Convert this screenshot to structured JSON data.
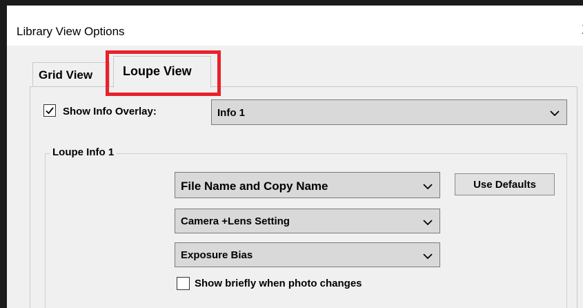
{
  "window": {
    "title": "Library View Options",
    "close_glyph": "X"
  },
  "tabs": [
    {
      "label": "Grid View",
      "selected": false
    },
    {
      "label": "Loupe View",
      "selected": true
    }
  ],
  "highlight": {
    "color": "#e8212b",
    "target": "Loupe View tab"
  },
  "overlay": {
    "checkbox_label": "Show Info Overlay:",
    "checked": true,
    "selected_value": "Info 1"
  },
  "loupe_info": {
    "group_label": "Loupe Info 1",
    "fields": [
      {
        "value": "File Name and Copy Name"
      },
      {
        "value": "Camera +Lens Setting"
      },
      {
        "value": "Exposure Bias"
      }
    ],
    "use_defaults_label": "Use Defaults",
    "show_briefly_label": "Show briefly when photo changes",
    "show_briefly_checked": false
  },
  "icons": {
    "checkbox_checked": "check-icon",
    "dropdown": "chevron-down-icon"
  },
  "colors": {
    "dialog_background": "#f0f0f0",
    "combo_background": "#d9d9d9",
    "button_background": "#e1e1e1"
  }
}
